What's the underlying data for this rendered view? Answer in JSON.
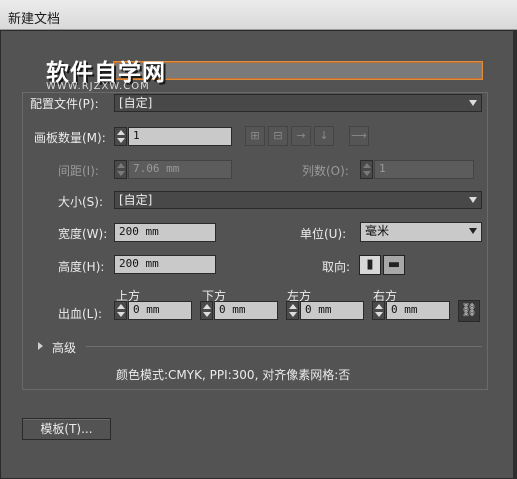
{
  "window": {
    "title": "新建文档"
  },
  "watermark": {
    "main": "软件自学网",
    "sub": "WWW.RJZXW.COM"
  },
  "name_field": {
    "value": ""
  },
  "profile": {
    "label": "配置文件(P):",
    "value": "[自定]"
  },
  "artboards": {
    "count_label": "画板数量(M):",
    "count_value": "1",
    "spacing_label": "间距(I):",
    "spacing_value": "7.06 mm",
    "columns_label": "列数(O):",
    "columns_value": "1",
    "arrange_icons": [
      "grid-by-row-icon",
      "grid-by-column-icon",
      "arrange-by-row-icon",
      "arrange-by-column-icon",
      "right-to-left-icon"
    ]
  },
  "size": {
    "label": "大小(S):",
    "value": "[自定]"
  },
  "width": {
    "label": "宽度(W):",
    "value": "200 mm"
  },
  "height": {
    "label": "高度(H):",
    "value": "200 mm"
  },
  "units": {
    "label": "单位(U):",
    "value": "毫米"
  },
  "orientation": {
    "label": "取向:",
    "options": [
      "portrait",
      "landscape"
    ],
    "selected": "portrait"
  },
  "bleed": {
    "label": "出血(L):",
    "top_label": "上方",
    "top_value": "0 mm",
    "bottom_label": "下方",
    "bottom_value": "0 mm",
    "left_label": "左方",
    "left_value": "0 mm",
    "right_label": "右方",
    "right_value": "0 mm",
    "link_icon": "chain-link-icon"
  },
  "advanced": {
    "label": "高级",
    "expanded": false
  },
  "summary": {
    "text": "颜色模式:CMYK, PPI:300, 对齐像素网格:否"
  },
  "buttons": {
    "templates": "模板(T)..."
  },
  "colors": {
    "dialog_bg": "#535353",
    "field_bg": "#c9c9c9",
    "focus_ring": "#e08a3c"
  }
}
